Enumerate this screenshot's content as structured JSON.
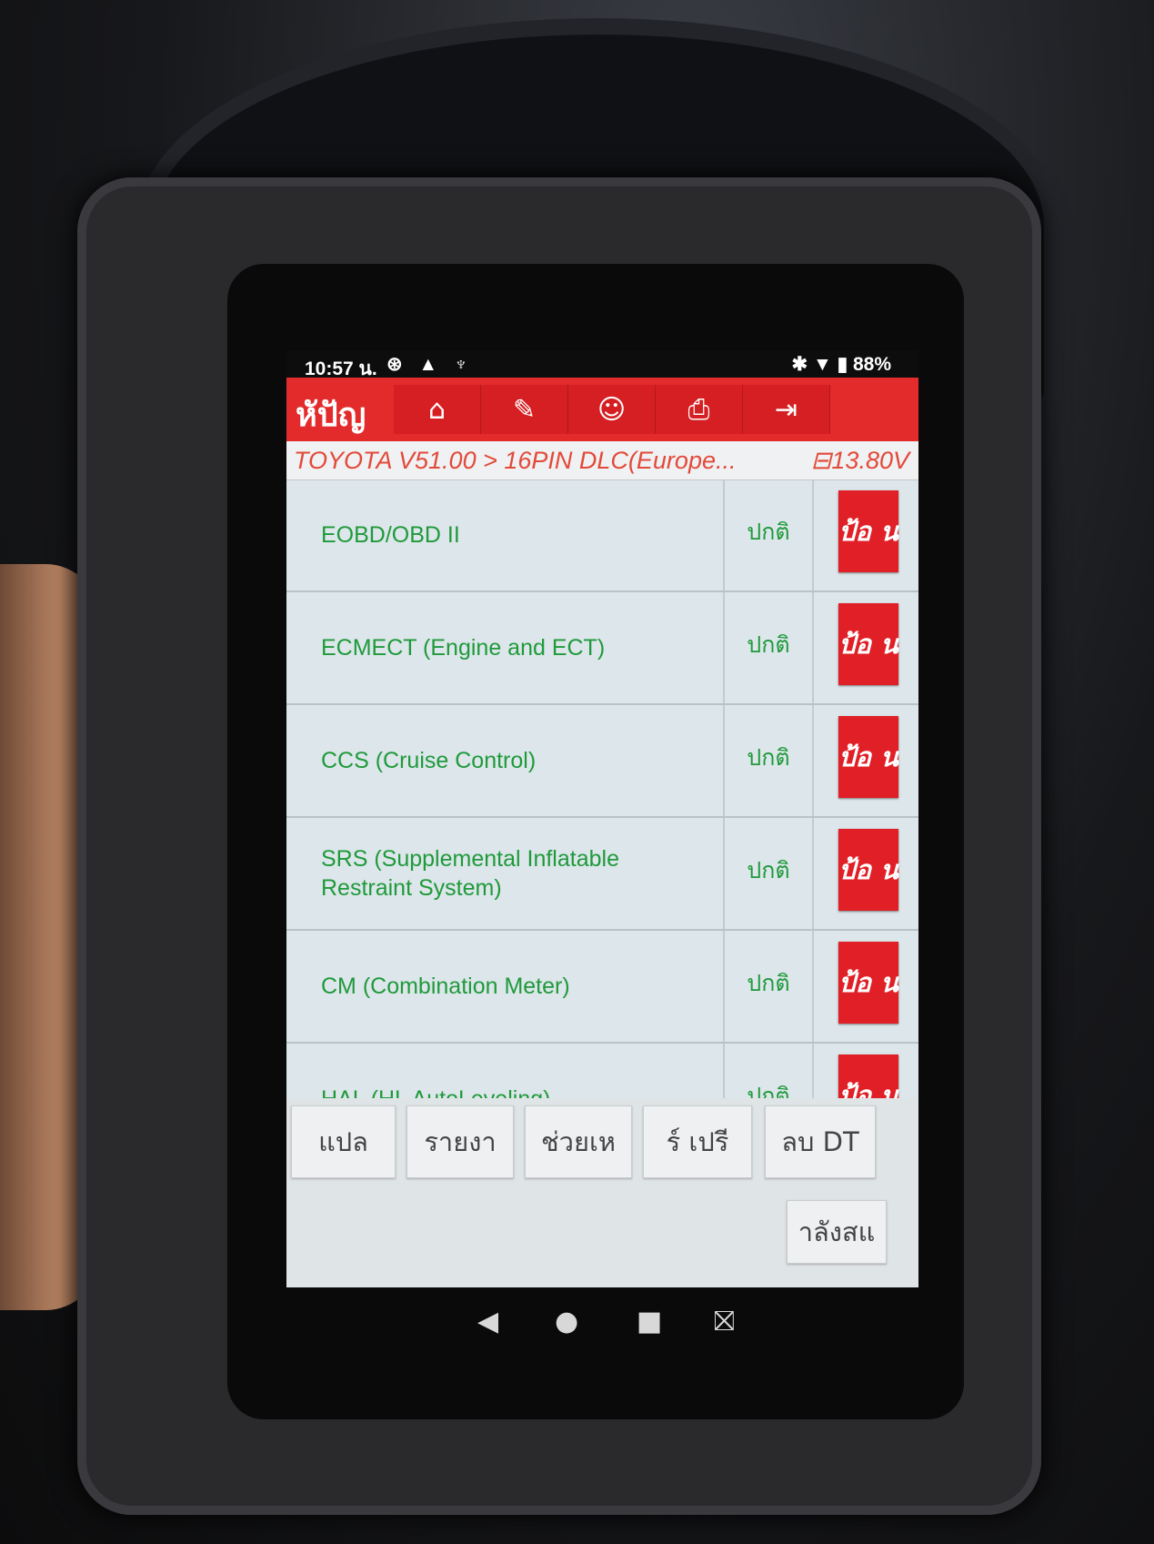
{
  "status_bar": {
    "time": "10:57 น.",
    "left_icons": "⊛ ▲ ♆",
    "right_icons": "✱ ▼ ▮",
    "battery": "88%"
  },
  "toolbar": {
    "brand": "หัปัญ",
    "buttons": [
      {
        "name": "home-icon",
        "glyph": "⌂"
      },
      {
        "name": "edit-icon",
        "glyph": "✎"
      },
      {
        "name": "user-icon",
        "glyph": "☺"
      },
      {
        "name": "print-icon",
        "glyph": "⎙"
      },
      {
        "name": "exit-icon",
        "glyph": "⇥"
      }
    ]
  },
  "breadcrumb": {
    "path": "TOYOTA V51.00 > 16PIN DLC(Europe...",
    "voltage": "⊟13.80V"
  },
  "systems": [
    {
      "name": "EOBD/OBD II",
      "status": "ปกติ",
      "action": "ป้อ น"
    },
    {
      "name": "ECMECT (Engine and ECT)",
      "status": "ปกติ",
      "action": "ป้อ น"
    },
    {
      "name": "CCS (Cruise Control)",
      "status": "ปกติ",
      "action": "ป้อ น"
    },
    {
      "name": "SRS (Supplemental Inflatable Restraint System)",
      "status": "ปกติ",
      "action": "ป้อ น"
    },
    {
      "name": "CM (Combination Meter)",
      "status": "ปกติ",
      "action": "ป้อ น"
    },
    {
      "name": "HAL (HL AutoLeveling)",
      "status": "ปกติ",
      "action": "ป้อ น"
    }
  ],
  "bottom_buttons": [
    {
      "label": "แปล"
    },
    {
      "label": "รายงา"
    },
    {
      "label": "ช่วยเห"
    },
    {
      "label": "ร์ เปรี"
    },
    {
      "label": "ลบ DT"
    }
  ],
  "bottom_last": "าลังสแ",
  "navigation": {
    "back": "◀",
    "home": "●",
    "recents": "■",
    "screenshot": "⛝"
  },
  "colors": {
    "toolbar_red": "#e32b2b",
    "text_green": "#1f9a3b",
    "button_red": "#e01f26"
  }
}
